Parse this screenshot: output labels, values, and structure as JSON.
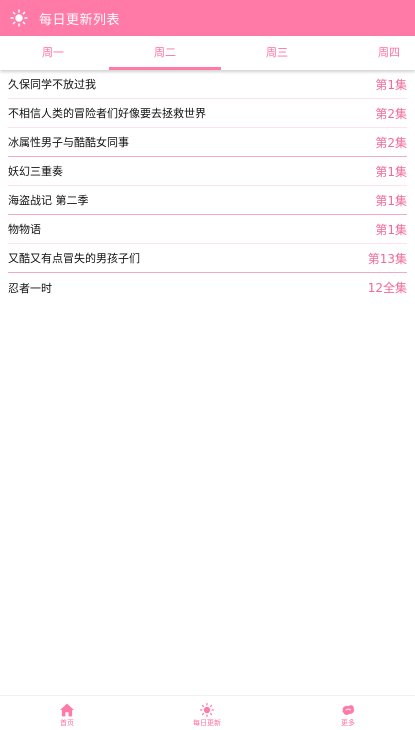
{
  "colors": {
    "accent": "#ff7aa6",
    "accent_text": "#f06a99",
    "divider_light": "#fde3ec",
    "divider_strong": "#f3aac5"
  },
  "header": {
    "icon": "sun-icon",
    "title": "每日更新列表"
  },
  "tabs": [
    {
      "label": "周一"
    },
    {
      "label": "周二"
    },
    {
      "label": "周三"
    },
    {
      "label": "周四"
    }
  ],
  "selected_tab": "周二",
  "list": [
    {
      "name": "久保同学不放过我",
      "episode": "第1集"
    },
    {
      "name": "不相信人类的冒险者们好像要去拯救世界",
      "episode": "第2集"
    },
    {
      "name": "冰属性男子与酷酷女同事",
      "episode": "第2集"
    },
    {
      "name": "妖幻三重奏",
      "episode": "第1集"
    },
    {
      "name": "海盗战记 第二季",
      "episode": "第1集"
    },
    {
      "name": "物物语",
      "episode": "第1集"
    },
    {
      "name": "又酷又有点冒失的男孩子们",
      "episode": "第13集"
    },
    {
      "name": "忍者一时",
      "episode": "12全集"
    }
  ],
  "bottom_nav": [
    {
      "icon": "home-icon",
      "label": "首页"
    },
    {
      "icon": "sun-icon",
      "label": "每日更新"
    },
    {
      "icon": "more-icon",
      "label": "更多"
    }
  ]
}
